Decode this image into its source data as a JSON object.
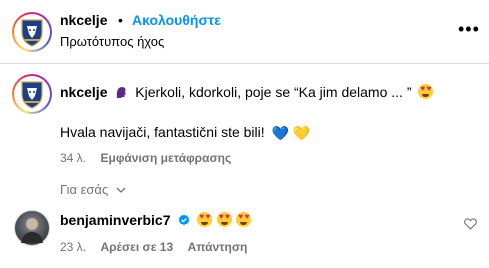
{
  "post_header": {
    "username": "nkcelje",
    "separator": "•",
    "follow_label": "Ακολουθήστε",
    "audio_label": "Πρωτότυπος ήχος",
    "more_icon": "more-horizontal-icon"
  },
  "caption": {
    "username": "nkcelje",
    "line1": "Kjerkoli, kdorkoli, poje se “Ka jim delamo ... ”",
    "line2": "Hvala navijači, fantastični ste bili!",
    "time": "34 λ.",
    "translation_label": "Εμφάνιση μετάφρασης",
    "heart_blue": "💙",
    "heart_yellow": "💛"
  },
  "for_you": {
    "label": "Για εσάς"
  },
  "comment": {
    "username": "benjaminverbic7",
    "time": "23 λ.",
    "likes_label": "Αρέσει σε 13",
    "reply_label": "Απάντηση",
    "like_icon": "heart-outline-icon"
  },
  "colors": {
    "link_blue": "#0095f6",
    "verified_blue": "#0095f6",
    "meta_gray": "#737373",
    "divider": "#dbdbdb"
  }
}
